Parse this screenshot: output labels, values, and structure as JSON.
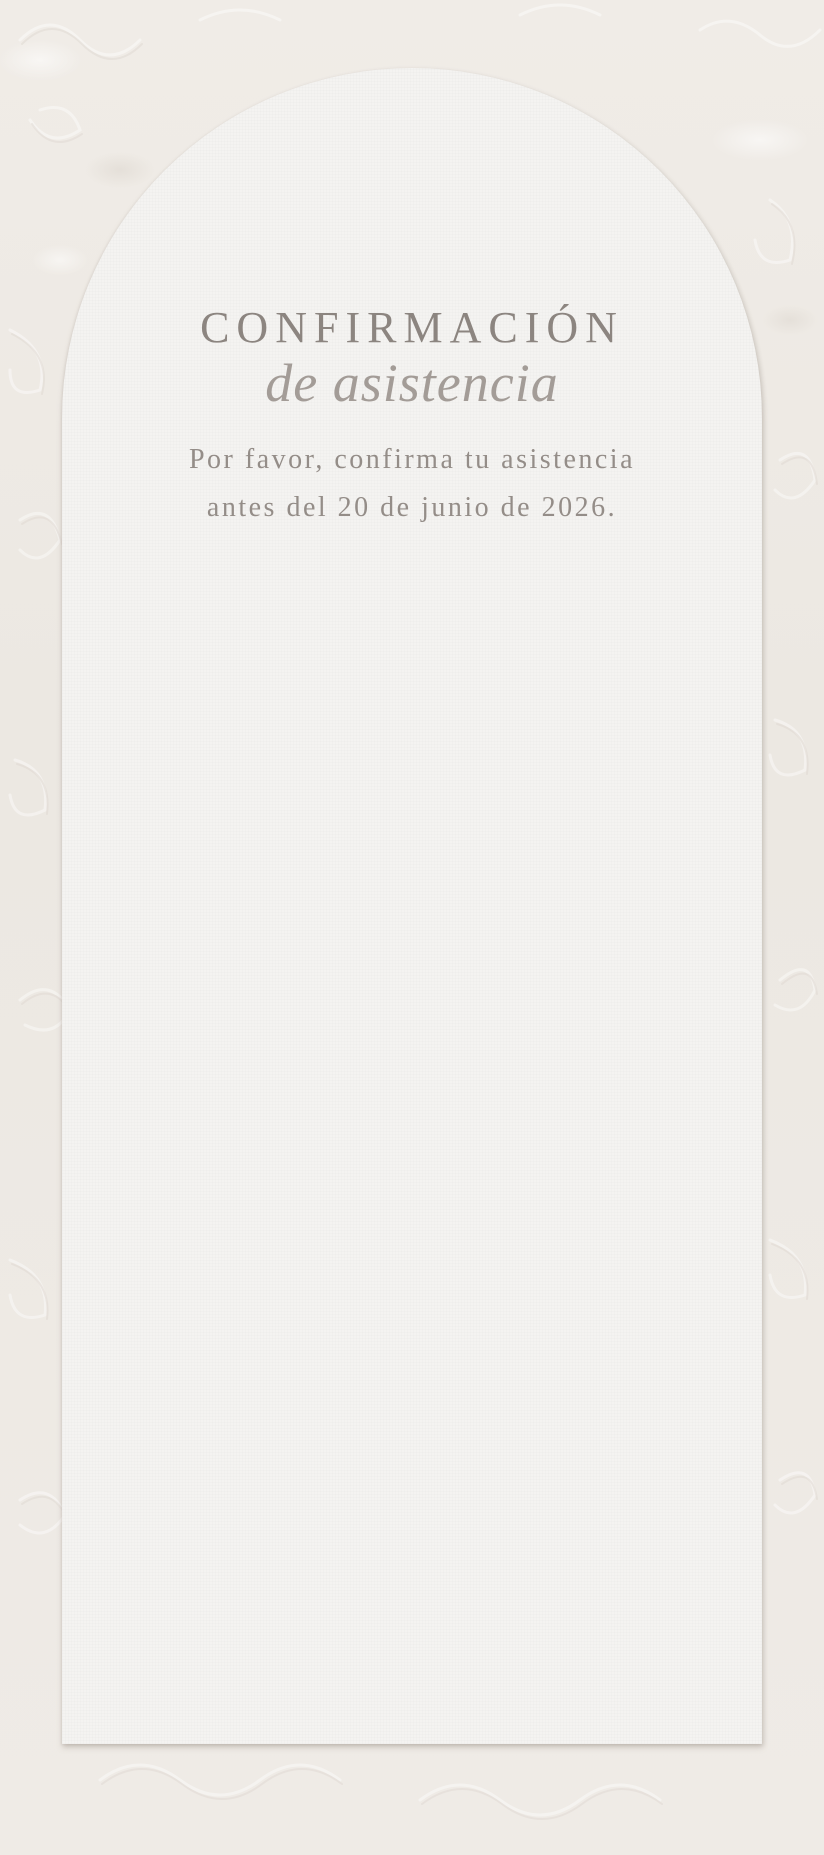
{
  "rsvp": {
    "title": "CONFIRMACIÓN",
    "subtitle": "de asistencia",
    "message_line1": "Por favor, confirma tu asistencia",
    "message_line2": "antes del 20 de junio de 2026."
  },
  "colors": {
    "background": "#efebe6",
    "card": "#f4f3f1",
    "text": "#8c8580"
  }
}
